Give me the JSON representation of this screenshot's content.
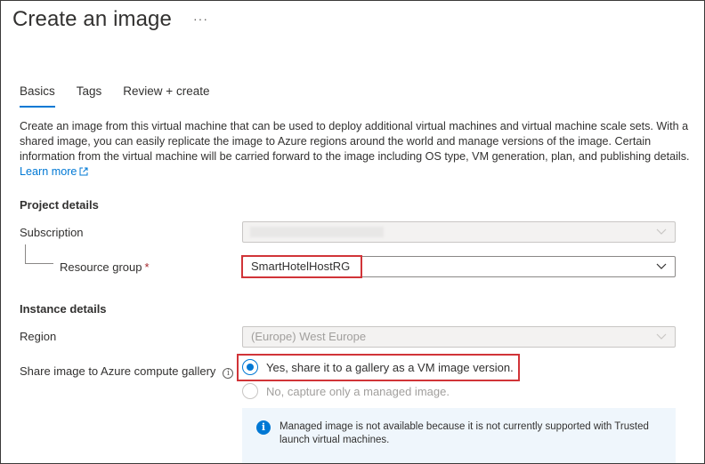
{
  "page": {
    "title": "Create an image",
    "more_icon": "ellipsis-icon"
  },
  "tabs": [
    {
      "label": "Basics",
      "active": true
    },
    {
      "label": "Tags",
      "active": false
    },
    {
      "label": "Review + create",
      "active": false
    }
  ],
  "description": {
    "text": "Create an image from this virtual machine that can be used to deploy additional virtual machines and virtual machine scale sets. With a shared image, you can easily replicate the image to Azure regions around the world and manage versions of the image. Certain information from the virtual machine will be carried forward to the image including OS type, VM generation, plan, and publishing details.",
    "link_text": "Learn more",
    "link_icon": "external-link-icon"
  },
  "project_details": {
    "header": "Project details",
    "subscription": {
      "label": "Subscription",
      "value": ""
    },
    "resource_group": {
      "label": "Resource group",
      "required_mark": "*",
      "value": "SmartHotelHostRG"
    }
  },
  "instance_details": {
    "header": "Instance details",
    "region": {
      "label": "Region",
      "value": "(Europe) West Europe"
    },
    "share": {
      "label": "Share image to Azure compute gallery",
      "info_icon": "info-icon",
      "options": [
        {
          "label": "Yes, share it to a gallery as a VM image version.",
          "selected": true,
          "disabled": false
        },
        {
          "label": "No, capture only a managed image.",
          "selected": false,
          "disabled": true
        }
      ]
    }
  },
  "info_message": {
    "icon": "info-circle-icon",
    "text": "Managed image is not available because it is not currently supported with Trusted launch virtual machines."
  },
  "colors": {
    "accent": "#0078d4",
    "highlight": "#d13438",
    "info_background": "#eff6fc"
  }
}
